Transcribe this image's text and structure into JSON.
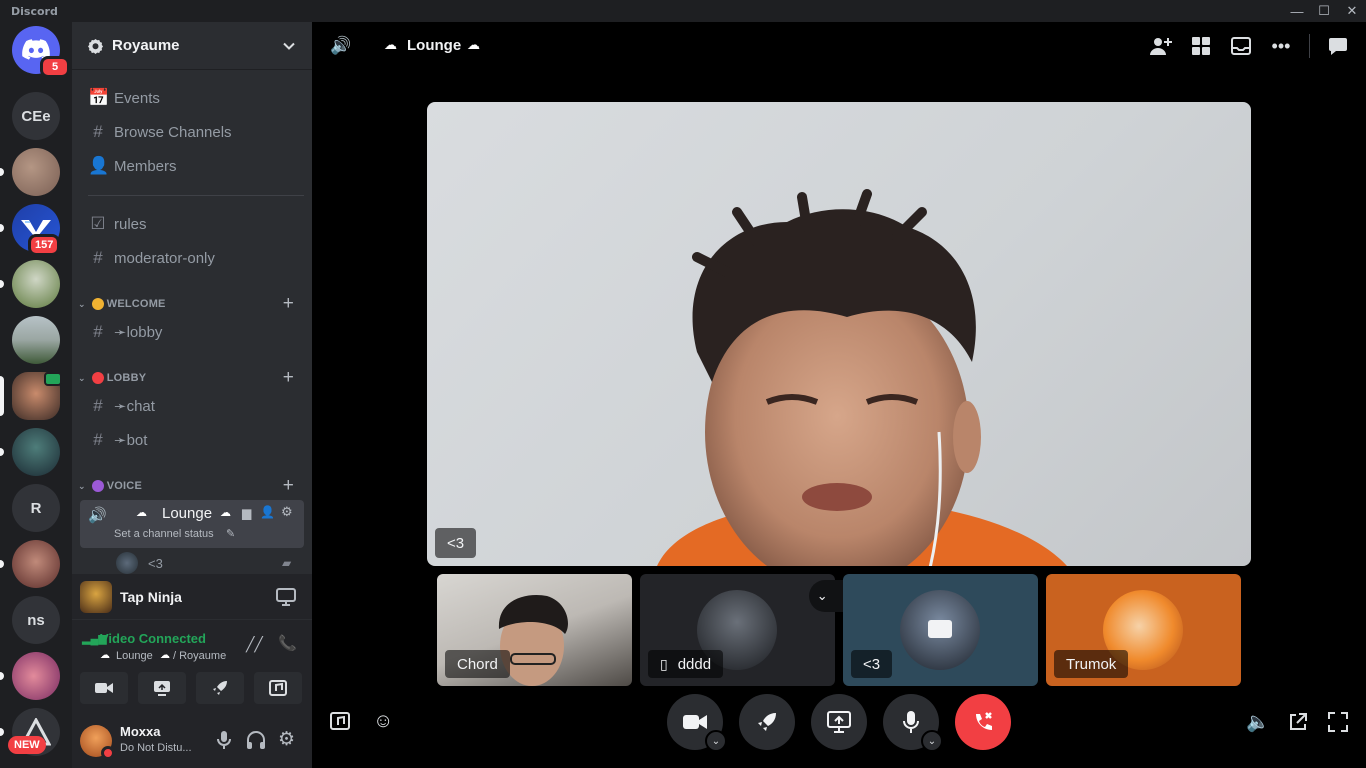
{
  "window": {
    "title": "Discord"
  },
  "rail": {
    "home_badge": "5",
    "servers": [
      {
        "label": "CEe"
      },
      {
        "label": ""
      },
      {
        "label": "",
        "badge": "157"
      },
      {
        "label": ""
      },
      {
        "label": ""
      },
      {
        "label": ""
      },
      {
        "label": ""
      },
      {
        "label": "R"
      },
      {
        "label": ""
      },
      {
        "label": "ns"
      },
      {
        "label": ""
      }
    ],
    "new_badge": "NEW"
  },
  "sidebar": {
    "guild_name": "Royaume",
    "nav": [
      {
        "label": "Events",
        "icon": "calendar-icon"
      },
      {
        "label": "Browse Channels",
        "icon": "browse-channels-icon"
      },
      {
        "label": "Members",
        "icon": "members-icon"
      }
    ],
    "channels_top": [
      {
        "label": "rules",
        "icon": "rules-icon"
      },
      {
        "label": "moderator-only",
        "icon": "hash-lock-icon"
      }
    ],
    "categories": [
      {
        "label": "WELCOME",
        "color": "#f0b232",
        "channels": [
          "➛lobby"
        ]
      },
      {
        "label": "LOBBY",
        "color": "#f23f43",
        "channels": [
          "➛chat",
          "➛bot"
        ]
      },
      {
        "label": "VOICE",
        "color": "#9b59d6",
        "channels": []
      }
    ],
    "voice_channel": {
      "name": "Lounge",
      "status_placeholder": "Set a channel status",
      "member_name": "<3"
    },
    "activity": {
      "name": "Tap Ninja"
    },
    "voice_connection": {
      "status": "Video Connected",
      "channel": "Lounge",
      "server": "/ Royaume",
      "status_color": "#23a559"
    },
    "user": {
      "name": "Moxxa",
      "status": "Do Not Distu..."
    }
  },
  "main": {
    "channel_title": "Lounge",
    "stage_label": "<3",
    "tiles": [
      {
        "name": "Chord"
      },
      {
        "name": "dddd"
      },
      {
        "name": "<3"
      },
      {
        "name": "Trumok"
      }
    ]
  },
  "colors": {
    "accent": "#5865f2",
    "danger": "#f23f43",
    "online": "#23a559"
  }
}
